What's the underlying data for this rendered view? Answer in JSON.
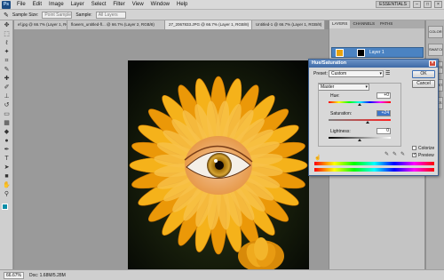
{
  "menubar": {
    "logo": "Ps",
    "items": [
      "File",
      "Edit",
      "Image",
      "Layer",
      "Select",
      "Filter",
      "View",
      "Window",
      "Help"
    ],
    "workspace": "ESSENTIALS",
    "win_min": "–",
    "win_max": "□",
    "win_close": "×"
  },
  "options": {
    "sample_size_label": "Sample Size:",
    "sample_size_value": "Point Sample",
    "sample_label": "Sample:",
    "sample_value": "All Layers"
  },
  "tabs": [
    "ef.jpg @ 66.7% (Layer 1, RGB/8)",
    "flowers_untitled-fl... @ 66.7% (Layer 2, RGB/8)",
    "27_2067833.JPG @ 66.7% (Layer 1, RGB/8)",
    "Untitled-1 @ 66.7% (Layer 1, RGB/8)"
  ],
  "panels": {
    "tabs": [
      "LAYERS",
      "CHANNELS",
      "PATHS"
    ],
    "layer_name": "Layer 1",
    "dock": [
      "COLOR",
      "SWATCHES",
      "STYLES",
      "ADJUST",
      "MASKS"
    ]
  },
  "status": {
    "zoom": "66.67%",
    "doc": "Doc: 1.68M/5.28M"
  },
  "dialog": {
    "title": "Hue/Saturation",
    "preset_label": "Preset:",
    "preset_value": "Custom",
    "channel_value": "Master",
    "hue_label": "Hue:",
    "hue_value": "+0",
    "saturation_label": "Saturation:",
    "saturation_value": "+24",
    "lightness_label": "Lightness:",
    "lightness_value": "0",
    "ok_label": "OK",
    "cancel_label": "Cancel",
    "colorize_label": "Colorize",
    "preview_label": "Preview",
    "colorize_checked": false,
    "preview_checked": true
  },
  "colors": {
    "foreground": "#0d8ea8",
    "background": "#ffffff",
    "petal": "#f2a60c"
  }
}
